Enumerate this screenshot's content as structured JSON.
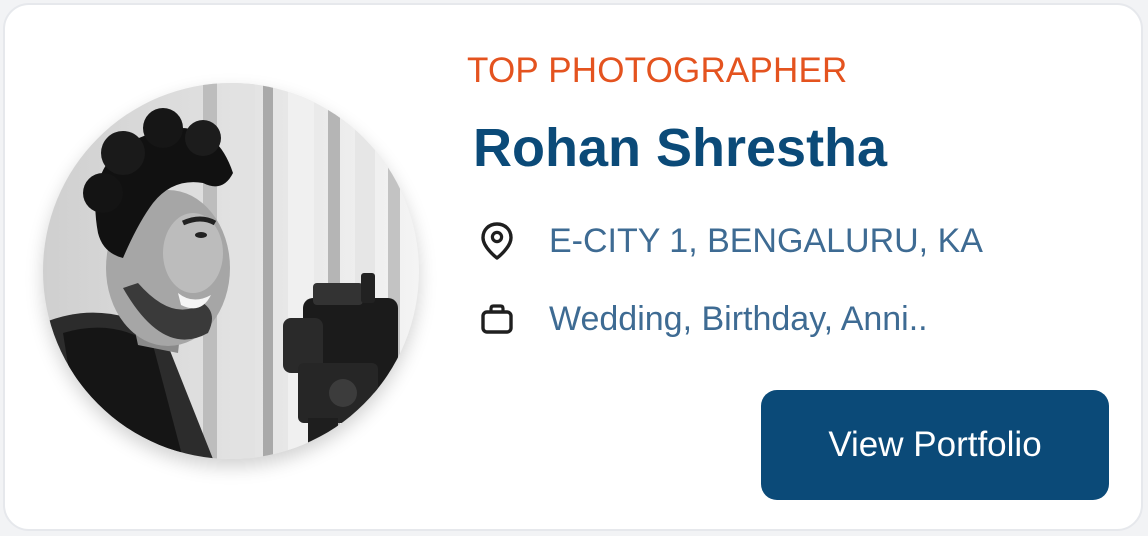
{
  "card": {
    "tagline": "TOP PHOTOGRAPHER",
    "name": "Rohan Shrestha",
    "location": {
      "icon": "location-pin-icon",
      "text": "E-CITY 1, BENGALURU, KA"
    },
    "services": {
      "icon": "briefcase-icon",
      "text": "Wedding, Birthday, Anni.."
    },
    "button_label": "View Portfolio",
    "avatar": "photographer-portrait"
  },
  "colors": {
    "tagline": "#e4531f",
    "name": "#0b4a78",
    "detail_text": "#3e6b93",
    "button_bg": "#0b4a78",
    "button_text": "#ffffff",
    "card_bg": "#ffffff"
  }
}
